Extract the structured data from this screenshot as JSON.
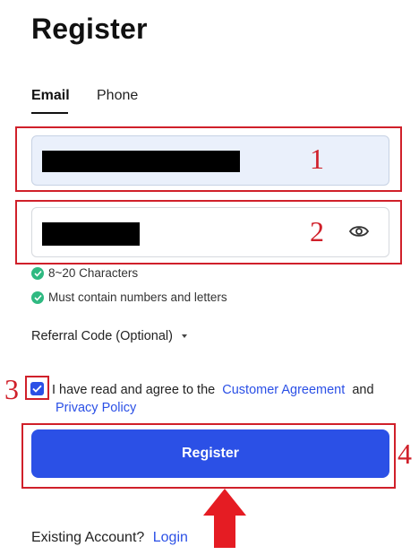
{
  "title": "Register",
  "tabs": [
    {
      "label": "Email",
      "active": true
    },
    {
      "label": "Phone",
      "active": false
    }
  ],
  "annotations": {
    "step1": "1",
    "step2": "2",
    "step3": "3",
    "step4": "4",
    "color": "#d0202a"
  },
  "email_field": {
    "value_redacted": true
  },
  "password_field": {
    "value_redacted": true,
    "toggle_icon": "eye-icon"
  },
  "password_rules": [
    {
      "label": "8~20 Characters",
      "icon": "check-circle-icon"
    },
    {
      "label": "Must contain numbers and letters",
      "icon": "check-circle-icon"
    }
  ],
  "referral": {
    "label": "Referral Code (Optional)",
    "icon": "caret-down-icon"
  },
  "agreement": {
    "checked": true,
    "prefix": "I have read and agree to the",
    "customer_agreement": "Customer Agreement",
    "and": "and",
    "privacy_policy": "Privacy Policy"
  },
  "register_button": {
    "label": "Register"
  },
  "footer": {
    "prompt": "Existing Account?",
    "login_link": "Login"
  },
  "colors": {
    "accent": "#2b50e6",
    "success": "#2fb981",
    "annotation": "#d0202a",
    "email_bg": "#eaf0fb"
  }
}
